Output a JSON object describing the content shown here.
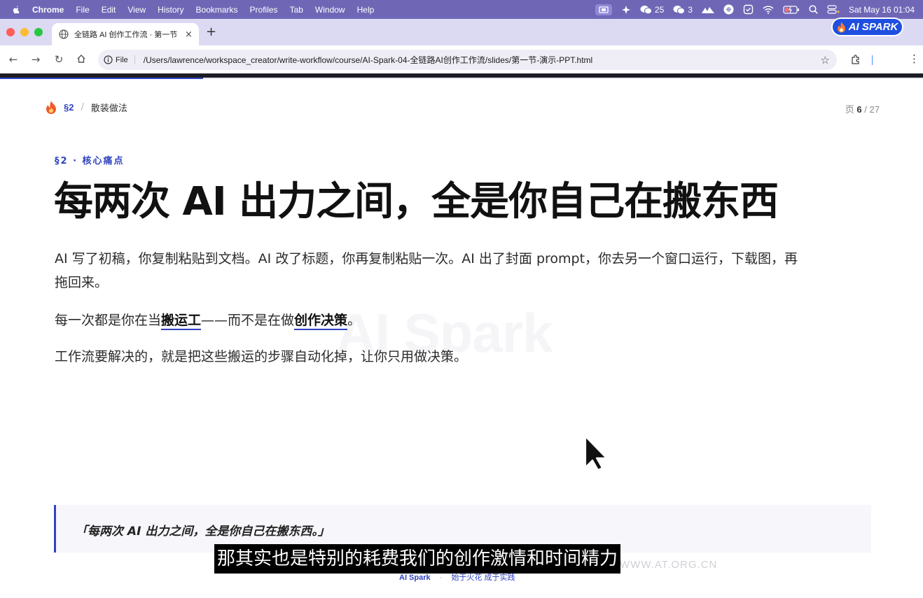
{
  "menubar": {
    "app": "Chrome",
    "items": [
      "File",
      "Edit",
      "View",
      "History",
      "Bookmarks",
      "Profiles",
      "Tab",
      "Window",
      "Help"
    ],
    "status": {
      "wechat_count": "25",
      "chat_count": "3",
      "datetime": "Sat May 16  01:04"
    }
  },
  "browser": {
    "tab_title": "全链路 AI 创作工作流 · 第一节",
    "tab_close": "×",
    "new_tab": "+",
    "brand_badge": "AI SPARK",
    "file_label": "File",
    "url": "/Users/lawrence/workspace_creator/write-workflow/course/AI-Spark-04-全链路AI创作工作流/slides/第一节-演示-PPT.html",
    "progress_fraction": 0.22
  },
  "slide": {
    "breadcrumb": {
      "section": "§2",
      "separator": "/",
      "title": "散装做法"
    },
    "pager": {
      "prefix": "页",
      "current": "6",
      "sep": "/",
      "total": "27"
    },
    "eyebrow": "§2 · 核心痛点",
    "headline": "每两次 AI 出力之间，全是你自己在搬东西",
    "para1": "AI 写了初稿，你复制粘贴到文档。AI 改了标题，你再复制粘贴一次。AI 出了封面 prompt，你去另一个窗口运行，下载图，再拖回来。",
    "para2": {
      "before": "每一次都是你在当",
      "em1": "搬运工",
      "middle": "——而不是在做",
      "em2": "创作决策",
      "after": "。"
    },
    "para3": "工作流要解决的，就是把这些搬运的步骤自动化掉，让你只用做决策。",
    "watermark": "AI Spark",
    "quote": "「每两次 AI 出力之间，全是你自己在搬东西。」",
    "footer": {
      "brand": "AI Spark",
      "dot": "·",
      "slogan": "始于火花 成于实践"
    },
    "site_watermark": "WWW.AT.ORG.CN"
  },
  "subtitle": "那其实也是特别的耗费我们的创作激情和时间精力",
  "colors": {
    "menubar_bg": "#6f67b6",
    "tabstrip_bg": "#dcd9f3",
    "accent": "#2f43c0",
    "badge_bg": "#1f4fe0"
  }
}
